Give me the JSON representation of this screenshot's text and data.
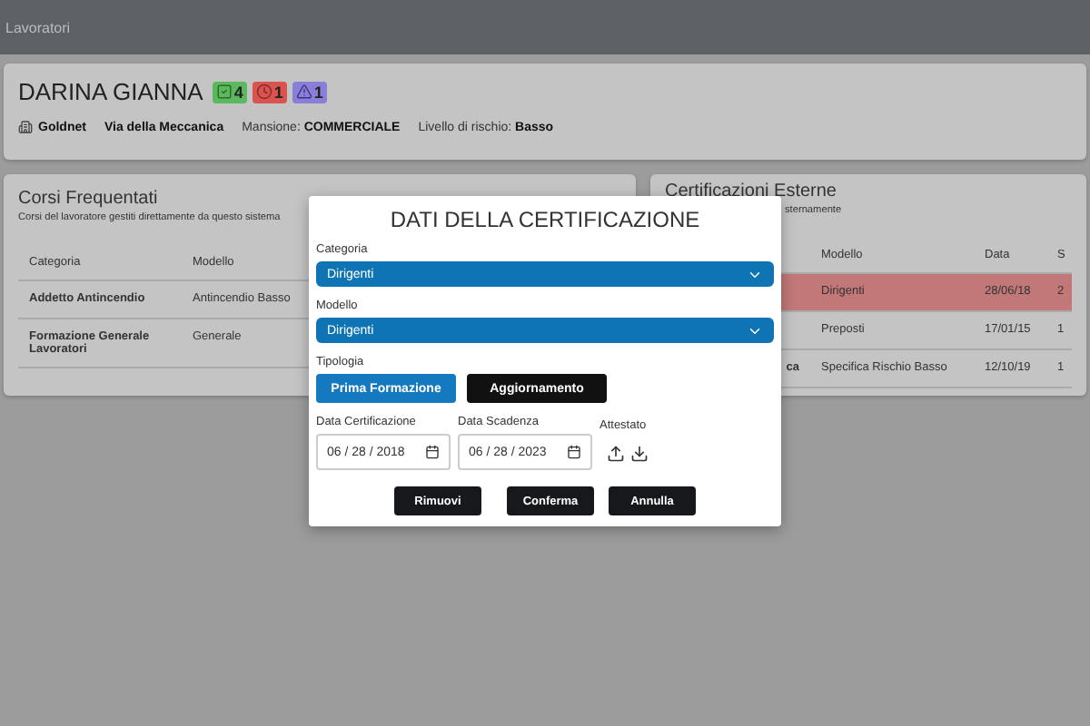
{
  "header": {
    "title": "Lavoratori"
  },
  "worker": {
    "name": "DARINA GIANNA",
    "badges": [
      {
        "kind": "check",
        "count": "4",
        "color": "#5cb85c"
      },
      {
        "kind": "clock",
        "count": "1",
        "color": "#d9534f"
      },
      {
        "kind": "warning",
        "count": "1",
        "color": "#8a7fd8"
      }
    ],
    "company": "Goldnet",
    "address": "Via della Meccanica",
    "role_label": "Mansione:",
    "role": "COMMERCIALE",
    "risk_label": "Livello di rischio:",
    "risk": "Basso"
  },
  "courses": {
    "title": "Corsi Frequentati",
    "subtitle": "Corsi del lavoratore gestiti direttamente da questo sistema",
    "columns": [
      "Categoria",
      "Modello"
    ],
    "rows": [
      {
        "cells": [
          "Addetto Antincendio",
          "Antincendio Basso"
        ]
      },
      {
        "cells": [
          "Formazione Generale Lavoratori",
          "Generale"
        ]
      }
    ]
  },
  "external": {
    "title": "Certificazioni Esterne",
    "subtitle": "sternamente",
    "columns": [
      "",
      "Modello",
      "Data",
      "S"
    ],
    "rows": [
      {
        "highlighted": true,
        "cells": [
          "",
          "Dirigenti",
          "28/06/18",
          "2"
        ]
      },
      {
        "highlighted": false,
        "cells": [
          "",
          "Preposti",
          "17/01/15",
          "1"
        ]
      },
      {
        "highlighted": false,
        "cells": [
          "ca",
          "Specifica Rischio Basso",
          "12/10/19",
          "1"
        ]
      }
    ]
  },
  "dialog": {
    "title": "DATI DELLA CERTIFICAZIONE",
    "category": {
      "label": "Categoria",
      "value": "Dirigenti"
    },
    "model": {
      "label": "Modello",
      "value": "Dirigenti"
    },
    "type_label": "Tipologia",
    "types": [
      {
        "label": "Prima Formazione",
        "selected": true
      },
      {
        "label": "Aggiornamento",
        "selected": false
      }
    ],
    "cert_date": {
      "label": "Data Certificazione",
      "value": "06 / 28 / 2018"
    },
    "expiry_date": {
      "label": "Data Scadenza",
      "value": "06 / 28 / 2023"
    },
    "attachment_label": "Attestato",
    "actions": [
      "Rimuovi",
      "Conferma",
      "Annulla"
    ]
  }
}
